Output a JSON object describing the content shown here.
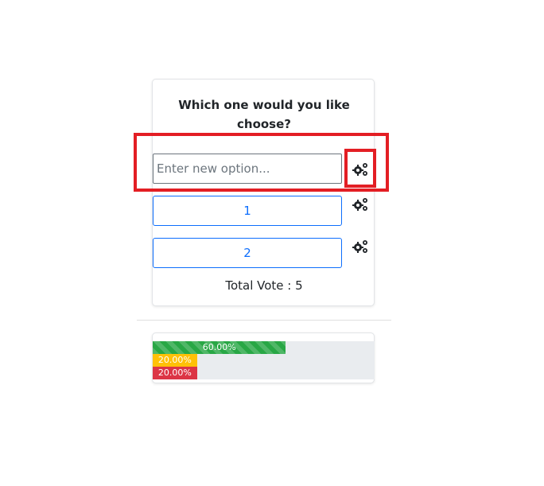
{
  "poll": {
    "question": "Which one would you like choose?",
    "new_option_placeholder": "Enter new option...",
    "options": [
      {
        "label": "1"
      },
      {
        "label": "2"
      }
    ],
    "total_vote": "Total Vote : 5"
  },
  "results": [
    {
      "label": "60.00%",
      "percent": 60,
      "color": "#28a745"
    },
    {
      "label": "20.00%",
      "percent": 20,
      "color": "#ffc107"
    },
    {
      "label": "20.00%",
      "percent": 20,
      "color": "#dc3545"
    }
  ],
  "icons": {
    "settings": "gears-icon"
  },
  "colors": {
    "highlight": "#e31e24",
    "primary": "#0d6efd"
  }
}
